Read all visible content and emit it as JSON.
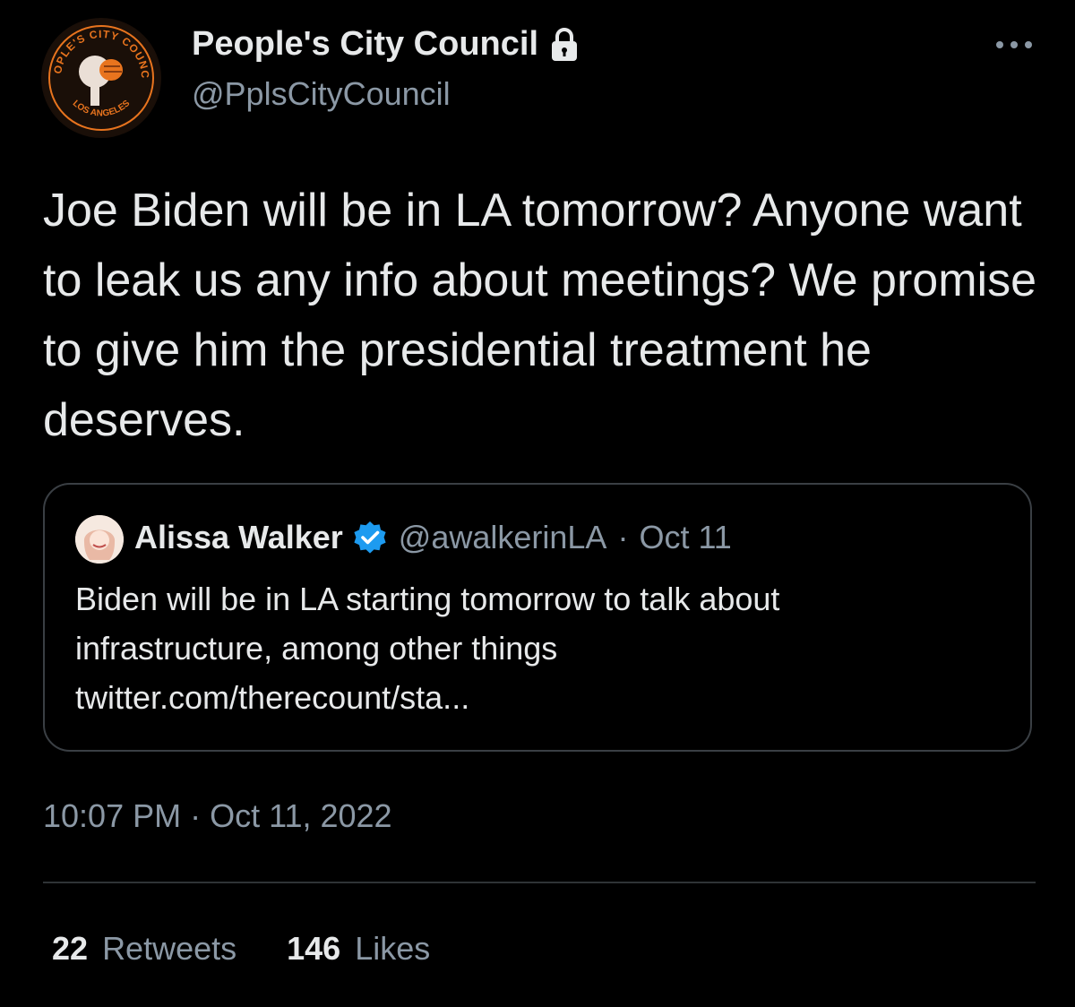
{
  "author": {
    "display_name": "People's City Council",
    "handle": "@PplsCityCouncil",
    "avatar_text_top": "PEOPLE'S CITY COUNCIL",
    "avatar_text_bottom": "LOS ANGELES"
  },
  "tweet": {
    "text": "Joe Biden will be in LA tomorrow? Anyone want to leak us any info about meetings? We promise to give him the presidential treatment he deserves.",
    "timestamp": "10:07 PM · Oct 11, 2022"
  },
  "quote": {
    "display_name": "Alissa Walker",
    "handle": "@awalkerinLA",
    "separator": "·",
    "date": "Oct 11",
    "text_line1": "Biden will be in LA starting tomorrow to talk about",
    "text_line2": "infrastructure, among other things",
    "text_line3": "twitter.com/therecount/sta..."
  },
  "stats": {
    "retweets_count": "22",
    "retweets_label": "Retweets",
    "likes_count": "146",
    "likes_label": "Likes"
  },
  "icons": {
    "lock": "lock-icon",
    "verified": "verified-badge-icon",
    "more": "more-options-icon"
  },
  "colors": {
    "background": "#000000",
    "text": "#e7e9ea",
    "secondary_text": "#8b98a5",
    "verified": "#1d9bf0",
    "logo_orange": "#e8741e"
  }
}
